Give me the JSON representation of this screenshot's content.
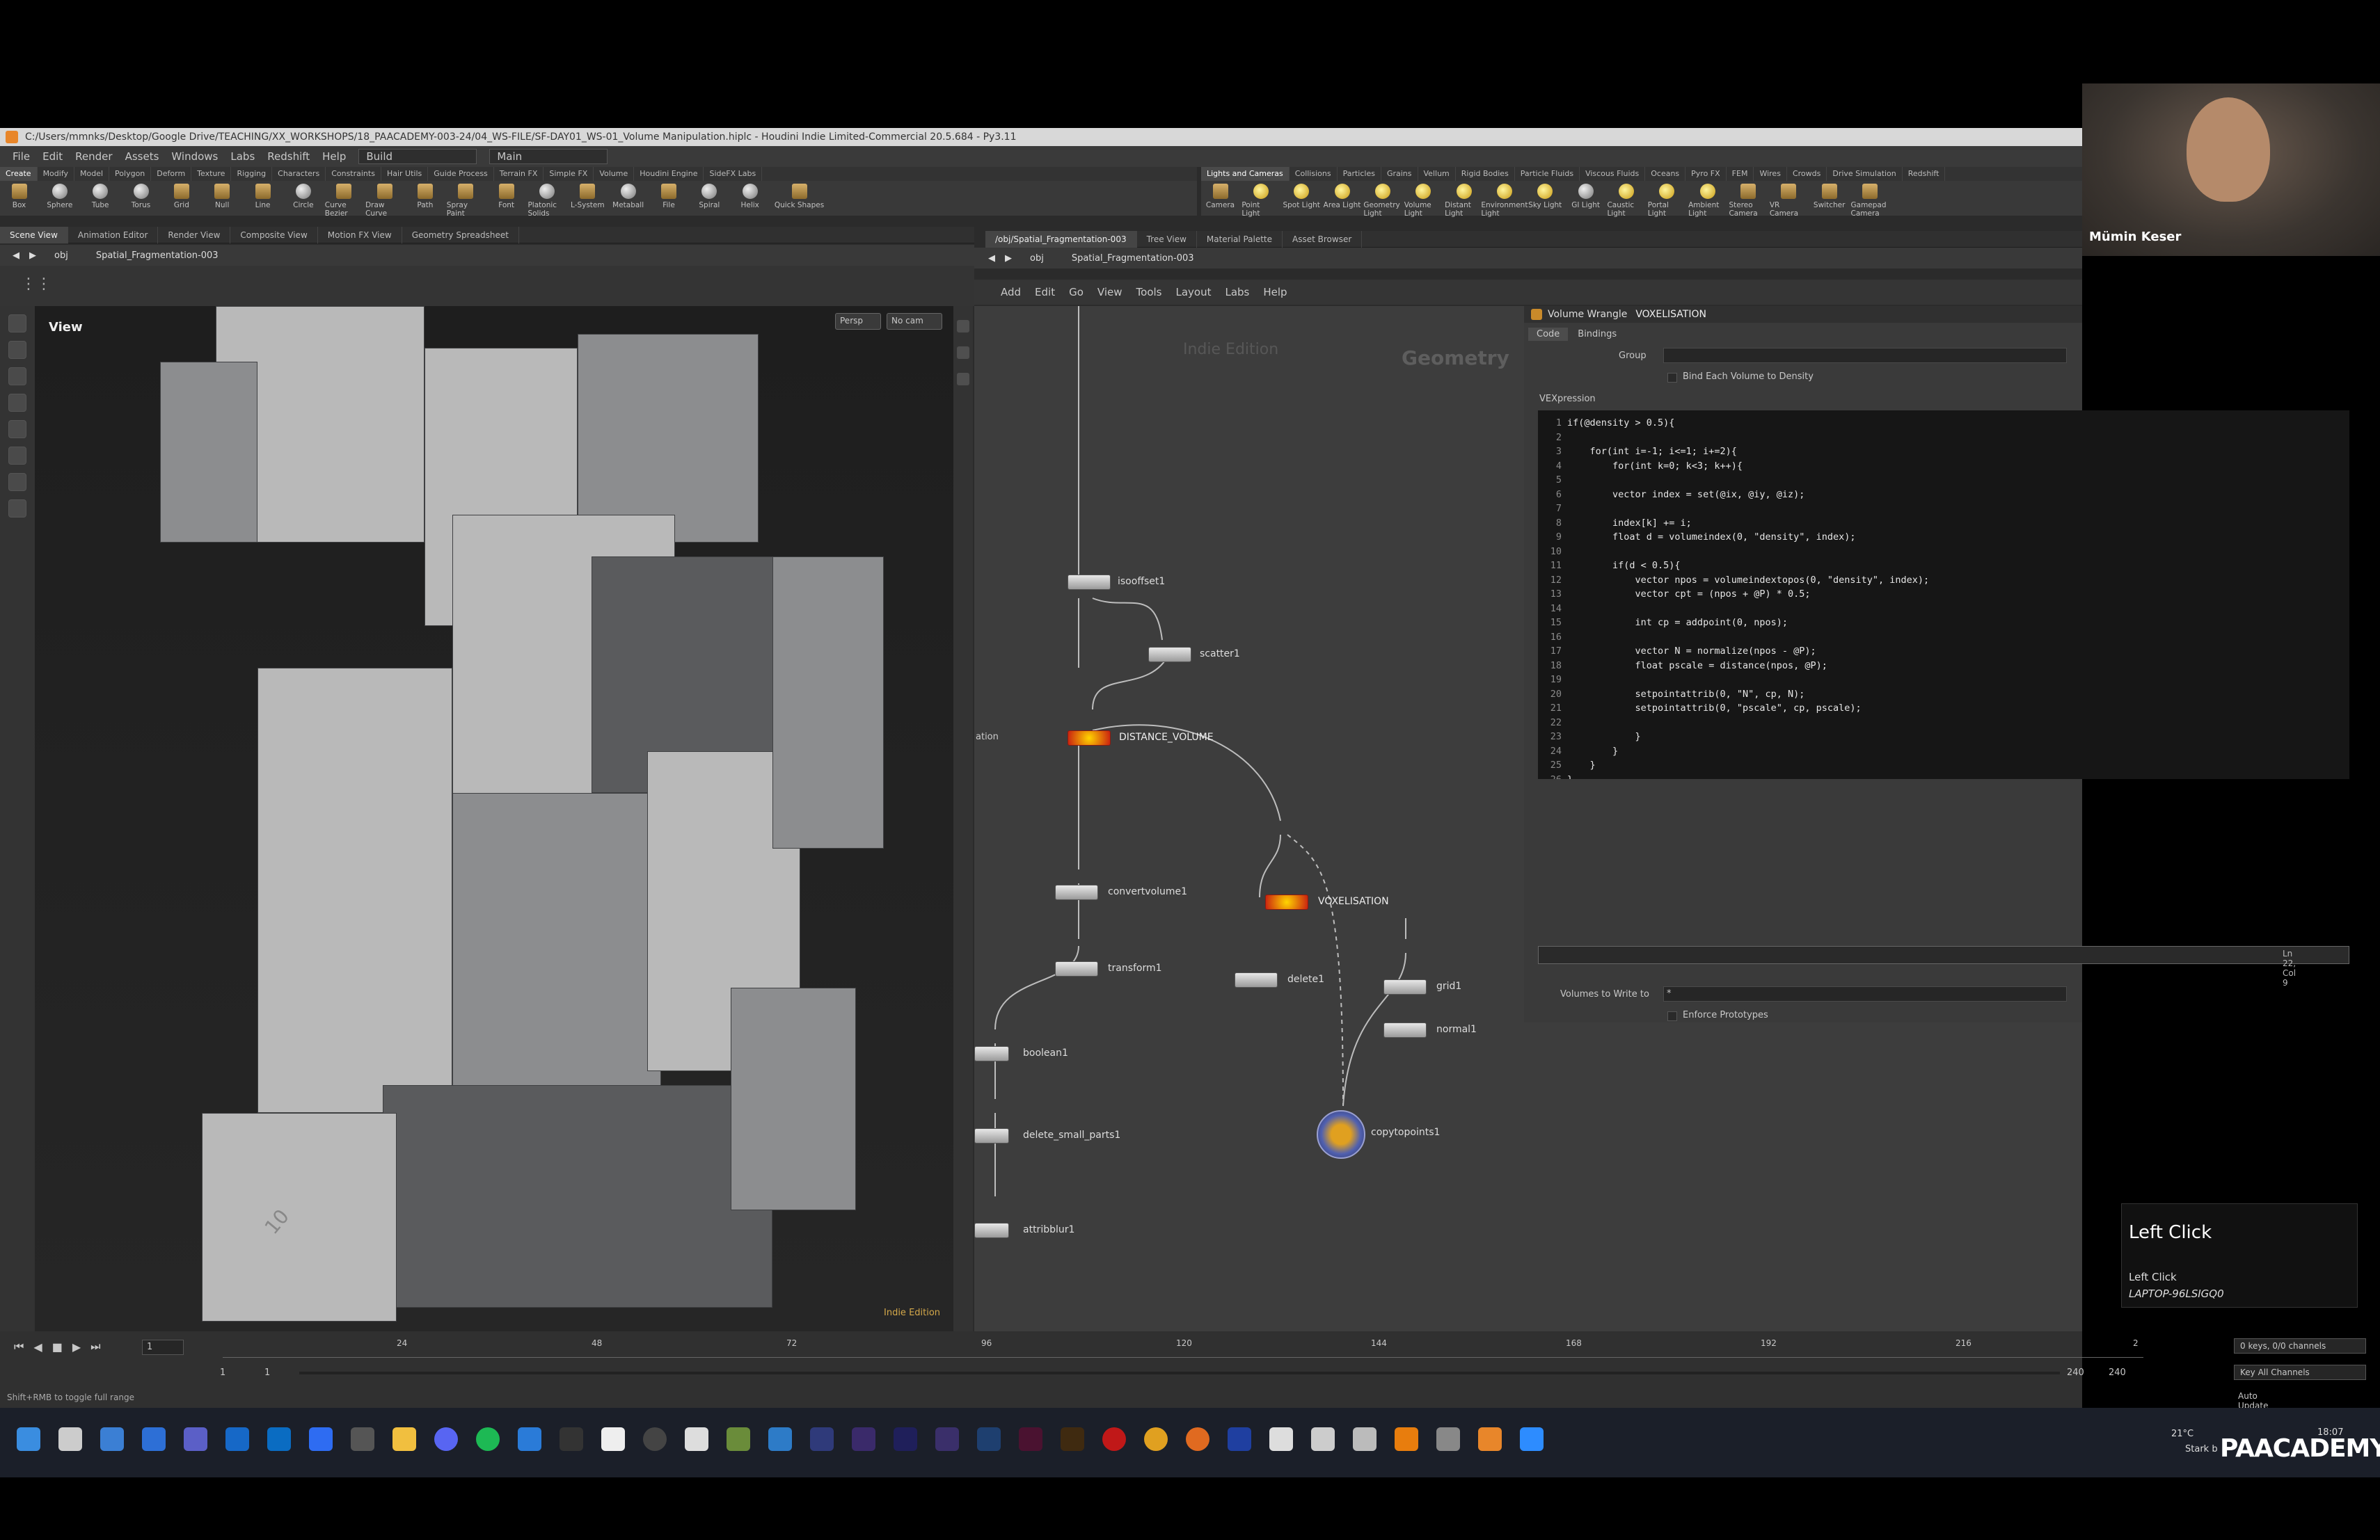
{
  "window": {
    "title": "C:/Users/mmnks/Desktop/Google Drive/TEACHING/XX_WORKSHOPS/18_PAACADEMY-003-24/04_WS-FILE/SF-DAY01_WS-01_Volume Manipulation.hiplc - Houdini Indie Limited-Commercial 20.5.684 - Py3.11"
  },
  "menu": {
    "items": [
      "File",
      "Edit",
      "Render",
      "Assets",
      "Windows",
      "Labs",
      "Redshift",
      "Help"
    ],
    "desktop": "Build",
    "network": "Main"
  },
  "shelf_tabs_left": [
    "Create",
    "Modify",
    "Model",
    "Polygon",
    "Deform",
    "Texture",
    "Rigging",
    "Characters",
    "Constraints",
    "Hair Utils",
    "Guide Process",
    "Terrain FX",
    "Simple FX",
    "Volume",
    "Houdini Engine",
    "SideFX Labs"
  ],
  "shelf_tabs_right": [
    "Lights and Cameras",
    "Collisions",
    "Particles",
    "Grains",
    "Vellum",
    "Rigid Bodies",
    "Particle Fluids",
    "Viscous Fluids",
    "Oceans",
    "Pyro FX",
    "FEM",
    "Wires",
    "Crowds",
    "Drive Simulation",
    "Redshift"
  ],
  "shelf_tools_left": [
    "Box",
    "Sphere",
    "Tube",
    "Torus",
    "Grid",
    "Null",
    "Line",
    "Circle",
    "Curve Bezier",
    "Draw Curve",
    "Path",
    "Spray Paint",
    "Font",
    "Platonic Solids",
    "L-System",
    "Metaball",
    "File",
    "Spiral",
    "Helix",
    "Quick Shapes"
  ],
  "shelf_tools_right": [
    "Camera",
    "Point Light",
    "Spot Light",
    "Area Light",
    "Geometry Light",
    "Volume Light",
    "Distant Light",
    "Environment Light",
    "Sky Light",
    "GI Light",
    "Caustic Light",
    "Portal Light",
    "Ambient Light",
    "Stereo Camera",
    "VR Camera",
    "Switcher",
    "Gamepad Camera"
  ],
  "left_pane_tabs": [
    "Scene View",
    "Animation Editor",
    "Render View",
    "Composite View",
    "Motion FX View",
    "Geometry Spreadsheet"
  ],
  "right_pane_tabs": [
    "/obj/Spatial_Fragmentation-003",
    "Tree View",
    "Material Palette",
    "Asset Browser"
  ],
  "path": {
    "obj": "obj",
    "node": "Spatial_Fragmentation-003"
  },
  "viewport": {
    "label": "View",
    "persp": "Persp",
    "cam": "No cam",
    "watermark": "Indie Edition",
    "axis_num": "10"
  },
  "network": {
    "menu": [
      "Add",
      "Edit",
      "Go",
      "View",
      "Tools",
      "Layout",
      "Labs",
      "Help"
    ],
    "watermark": "Indie Edition",
    "context": "Geometry",
    "side_label": "ation",
    "nodes": [
      "isooffset1",
      "scatter1",
      "DISTANCE_VOLUME",
      "convertvolume1",
      "VOXELISATION",
      "transform1",
      "delete1",
      "grid1",
      "normal1",
      "boolean1",
      "delete_small_parts1",
      "copytopoints1",
      "attribblur1"
    ]
  },
  "params": {
    "type": "Volume Wrangle",
    "name": "VOXELISATION",
    "tabs": [
      "Code",
      "Bindings"
    ],
    "group_label": "Group",
    "bind_label": "Bind Each Volume to Density",
    "vex_label": "VEXpression",
    "status": "Ln 22, Col 9",
    "write_label": "Volumes to Write to",
    "write_value": "*",
    "enforce_label": "Enforce Prototypes"
  },
  "code_lines": [
    "if(@density > 0.5){",
    "",
    "    for(int i=-1; i<=1; i+=2){",
    "        for(int k=0; k<3; k++){",
    "",
    "        vector index = set(@ix, @iy, @iz);",
    "",
    "        index[k] += i;",
    "        float d = volumeindex(0, \"density\", index);",
    "",
    "        if(d < 0.5){",
    "            vector npos = volumeindextopos(0, \"density\", index);",
    "            vector cpt = (npos + @P) * 0.5;",
    "",
    "            int cp = addpoint(0, npos);",
    "",
    "            vector N = normalize(npos - @P);",
    "            float pscale = distance(npos, @P);",
    "",
    "            setpointattrib(0, \"N\", cp, N);",
    "            setpointattrib(0, \"pscale\", cp, pscale);",
    "",
    "            }",
    "        }",
    "    }",
    "}"
  ],
  "timeline": {
    "frame": "1",
    "ticks": [
      "24",
      "48",
      "72",
      "96",
      "120",
      "144",
      "168",
      "192",
      "216",
      "2"
    ],
    "start": "1",
    "start2": "1",
    "end": "240",
    "end2": "240",
    "keys": "0 keys, 0/0 channels",
    "keyall": "Key All Channels",
    "auto": "Auto Update",
    "status": "Shift+RMB to toggle full range"
  },
  "webcam": {
    "name": "Mümin Keser"
  },
  "toast": {
    "title": "Left Click",
    "line1": "Left Click",
    "line2": "LAPTOP-96LSIGQ0"
  },
  "tray": {
    "temp": "21°C",
    "weather": "Stark b",
    "time": "18:07",
    "brand": "PAACADEMY"
  }
}
